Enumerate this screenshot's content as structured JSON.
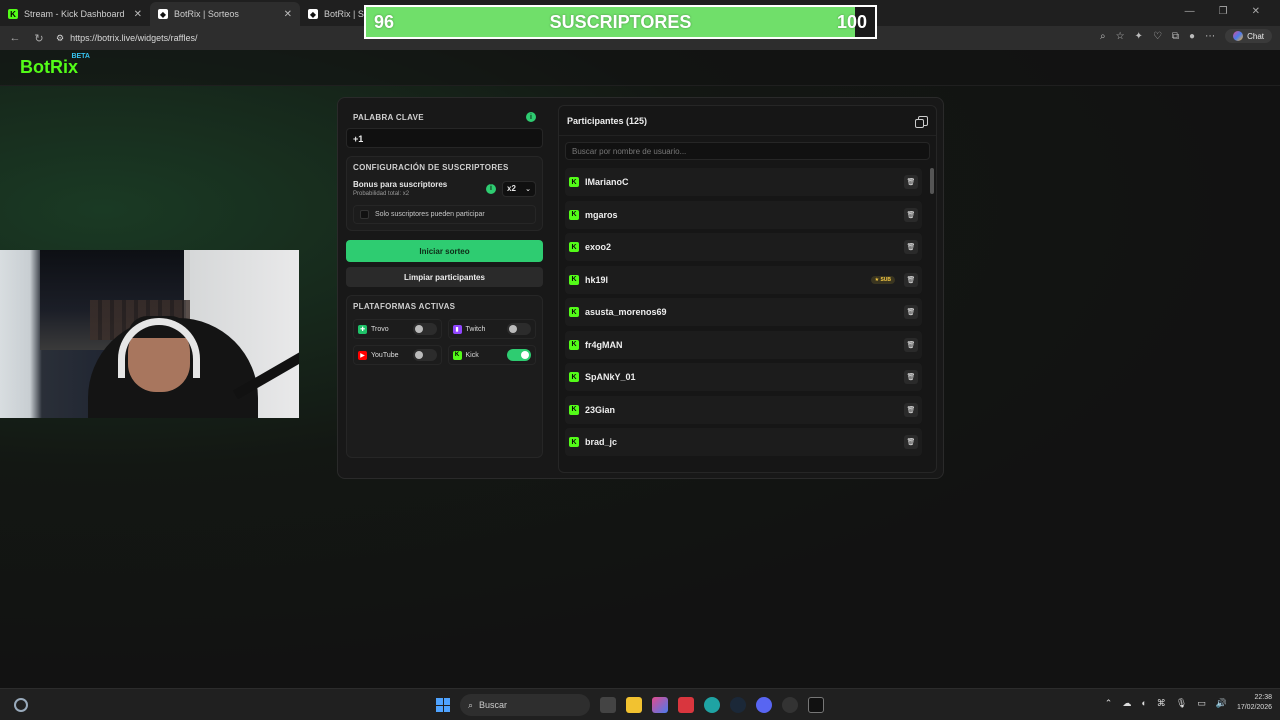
{
  "browser": {
    "tabs": [
      {
        "title": "Stream - Kick Dashboard",
        "icon": "kick-icon"
      },
      {
        "title": "BotRix | Sorteos",
        "icon": "botrix-icon"
      },
      {
        "title": "BotRix | Sor",
        "icon": "botrix-icon"
      }
    ],
    "url": "https://botrix.live/widgets/raffles/",
    "chat_label": "Chat"
  },
  "sub_overlay": {
    "current": "96",
    "label": "SUSCRIPTORES",
    "goal": "100",
    "progress": 0.96,
    "fill_color": "#70df6a"
  },
  "app": {
    "brand": "BotRix",
    "brand_badge": "BETA"
  },
  "raffle": {
    "keyword_label": "PALABRA CLAVE",
    "keyword_value": "+1",
    "sub_config_label": "CONFIGURACIÓN DE SUSCRIPTORES",
    "bonus_title": "Bonus para suscriptores",
    "bonus_sub": "Probabilidad total: x2",
    "multiplier": "x2",
    "only_subs_label": "Solo suscriptores pueden participar",
    "start_button": "Iniciar sorteo",
    "clear_button": "Limpiar participantes",
    "platforms_label": "PLATAFORMAS ACTIVAS",
    "platforms": [
      {
        "name": "Trovo",
        "on": false,
        "color": "#1fc269"
      },
      {
        "name": "Twitch",
        "on": false,
        "color": "#9146ff"
      },
      {
        "name": "YouTube",
        "on": false,
        "color": "#ff0000"
      },
      {
        "name": "Kick",
        "on": true,
        "color": "#53fc18"
      }
    ]
  },
  "participants": {
    "title": "Participantes (125)",
    "search_placeholder": "Buscar por nombre de usuario...",
    "sub_badge": "SUB",
    "list": [
      {
        "name": "IMarianoC",
        "sub": false
      },
      {
        "name": "mgaros",
        "sub": false
      },
      {
        "name": "exoo2",
        "sub": false
      },
      {
        "name": "hk19l",
        "sub": true
      },
      {
        "name": "asusta_morenos69",
        "sub": false
      },
      {
        "name": "fr4gMAN",
        "sub": false
      },
      {
        "name": "SpANkY_01",
        "sub": false
      },
      {
        "name": "23Gian",
        "sub": false
      },
      {
        "name": "brad_jc",
        "sub": false
      }
    ]
  },
  "taskbar": {
    "search_label": "Buscar",
    "time": "22:38",
    "date": "17/02/2026"
  },
  "colors": {
    "accent_green": "#2ecc71",
    "kick_green": "#53fc18"
  }
}
